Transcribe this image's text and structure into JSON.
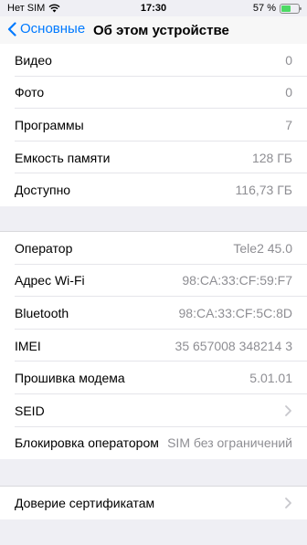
{
  "status": {
    "carrier": "Нет SIM",
    "time": "17:30",
    "battery": "57 %",
    "battery_level": 0.57
  },
  "nav": {
    "back_label": "Основные",
    "title": "Об этом устройстве"
  },
  "group1": [
    {
      "label": "Видео",
      "value": "0"
    },
    {
      "label": "Фото",
      "value": "0"
    },
    {
      "label": "Программы",
      "value": "7"
    },
    {
      "label": "Емкость памяти",
      "value": "128 ГБ"
    },
    {
      "label": "Доступно",
      "value": "116,73 ГБ"
    }
  ],
  "group2": [
    {
      "label": "Оператор",
      "value": "Tele2 45.0"
    },
    {
      "label": "Адрес Wi-Fi",
      "value": "98:CA:33:CF:59:F7"
    },
    {
      "label": "Bluetooth",
      "value": "98:CA:33:CF:5C:8D"
    },
    {
      "label": "IMEI",
      "value": "35 657008 348214 3"
    },
    {
      "label": "Прошивка модема",
      "value": "5.01.01"
    },
    {
      "label": "SEID",
      "value": ""
    },
    {
      "label": "Блокировка оператором",
      "value": "SIM без ограничений"
    }
  ],
  "group3": [
    {
      "label": "Доверие сертификатам",
      "value": ""
    }
  ]
}
